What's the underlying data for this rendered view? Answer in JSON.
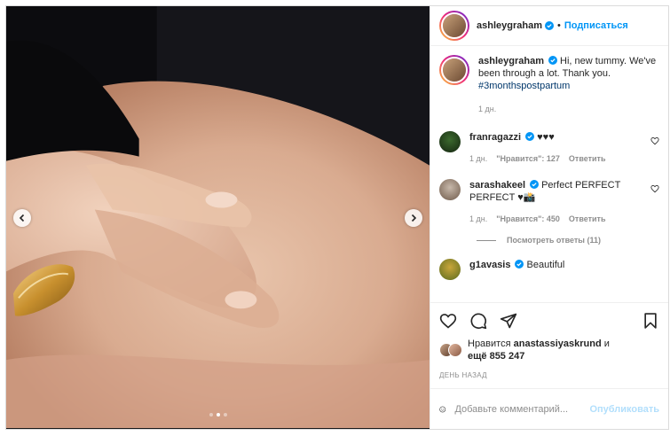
{
  "post": {
    "author": "ashleygraham",
    "follow_label": "Подписаться",
    "separator": "•",
    "caption_user": "ashleygraham",
    "caption_text": "Hi, new tummy. We've been through a lot. Thank you.",
    "caption_hashtag": "#3monthspostpartum",
    "caption_time": "1 дн."
  },
  "carousel": {
    "slides": 3,
    "active_index": 1
  },
  "comments": [
    {
      "user": "franragazzi",
      "text": "♥♥♥",
      "time": "1 дн.",
      "likes": "\"Нравится\": 127",
      "reply": "Ответить"
    },
    {
      "user": "sarashakeel",
      "text": "Perfect PERFECT PERFECT ♥📸",
      "time": "1 дн.",
      "likes": "\"Нравится\": 450",
      "reply": "Ответить"
    },
    {
      "user": "g1avasis",
      "text": "Beautiful"
    }
  ],
  "replies_toggle": "Посмотреть ответы (11)",
  "likes": {
    "prefix": "Нравится",
    "user": "anastassiyaskrund",
    "joiner": "и",
    "more": "ещё 855 247"
  },
  "timestamp": "ДЕНЬ НАЗАД",
  "add_comment": {
    "placeholder": "Добавьте комментарий...",
    "publish_label": "Опубликовать"
  },
  "colors": {
    "accent": "#0095f6",
    "publish_disabled": "#b2dffc",
    "muted": "#8e8e8e",
    "text": "#262626"
  },
  "icons": [
    "chevron-left-icon",
    "chevron-right-icon",
    "verified-icon",
    "heart-icon",
    "comment-icon",
    "share-icon",
    "bookmark-icon",
    "emoji-icon"
  ]
}
